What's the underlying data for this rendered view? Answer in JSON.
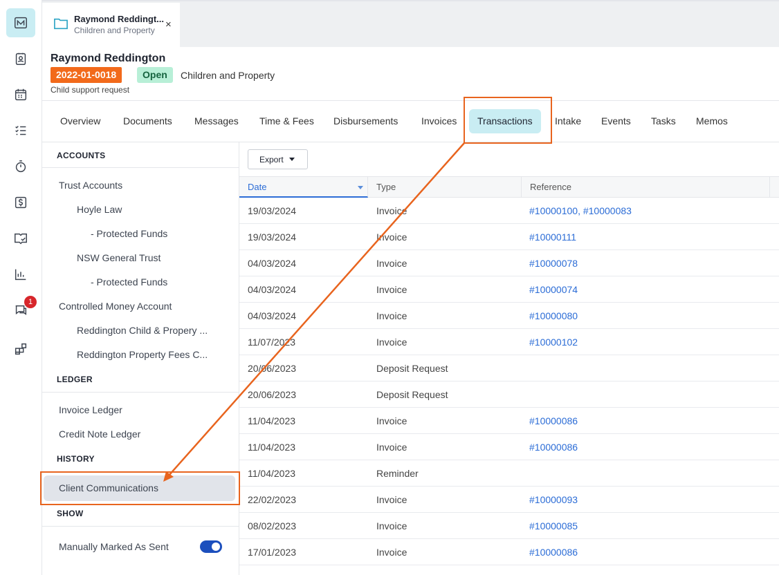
{
  "rail": {
    "items": [
      "matter-icon",
      "contacts-icon",
      "calendar-icon",
      "tasks-icon",
      "timer-icon",
      "billing-icon",
      "library-icon",
      "reports-icon",
      "communications-icon",
      "apps-icon"
    ],
    "badge": "1"
  },
  "tab": {
    "title": "Raymond Reddingt...",
    "subtitle": "Children and Property",
    "close": "×"
  },
  "header": {
    "client_name": "Raymond Reddington",
    "matter_number": "2022-01-0018",
    "status": "Open",
    "matter_type": "Children and Property",
    "description": "Child support request"
  },
  "nav": {
    "tabs": [
      "Overview",
      "Documents",
      "Messages",
      "Time & Fees",
      "Disbursements",
      "Invoices",
      "Transactions",
      "Intake",
      "Events",
      "Tasks",
      "Memos"
    ],
    "active": "Transactions"
  },
  "sidebar": {
    "accounts_heading": "ACCOUNTS",
    "trust_accounts": "Trust Accounts",
    "hoyle_law": "Hoyle Law",
    "protected_funds_1": "- Protected Funds",
    "nsw_general_trust": "NSW General Trust",
    "protected_funds_2": "- Protected Funds",
    "controlled_money": "Controlled Money Account",
    "cma_1": "Reddington Child & Propery ...",
    "cma_2": "Reddington Property Fees C...",
    "ledger_heading": "LEDGER",
    "invoice_ledger": "Invoice Ledger",
    "credit_note_ledger": "Credit Note Ledger",
    "history_heading": "HISTORY",
    "client_communications": "Client Communications",
    "show_heading": "SHOW",
    "manually_marked": "Manually Marked As Sent",
    "manually_marked_on": true
  },
  "grid": {
    "export_label": "Export",
    "columns": [
      "Date",
      "Type",
      "Reference"
    ],
    "rows": [
      {
        "date": "19/03/2024",
        "type": "Invoice",
        "ref": "#10000100, #10000083"
      },
      {
        "date": "19/03/2024",
        "type": "Invoice",
        "ref": "#10000111"
      },
      {
        "date": "04/03/2024",
        "type": "Invoice",
        "ref": "#10000078"
      },
      {
        "date": "04/03/2024",
        "type": "Invoice",
        "ref": "#10000074"
      },
      {
        "date": "04/03/2024",
        "type": "Invoice",
        "ref": "#10000080"
      },
      {
        "date": "11/07/2023",
        "type": "Invoice",
        "ref": "#10000102"
      },
      {
        "date": "20/06/2023",
        "type": "Deposit Request",
        "ref": ""
      },
      {
        "date": "20/06/2023",
        "type": "Deposit Request",
        "ref": ""
      },
      {
        "date": "11/04/2023",
        "type": "Invoice",
        "ref": "#10000086"
      },
      {
        "date": "11/04/2023",
        "type": "Invoice",
        "ref": "#10000086"
      },
      {
        "date": "11/04/2023",
        "type": "Reminder",
        "ref": ""
      },
      {
        "date": "22/02/2023",
        "type": "Invoice",
        "ref": "#10000093"
      },
      {
        "date": "08/02/2023",
        "type": "Invoice",
        "ref": "#10000085"
      },
      {
        "date": "17/01/2023",
        "type": "Invoice",
        "ref": "#10000086"
      }
    ]
  },
  "colors": {
    "accent_orange": "#e8641e",
    "active_tab_bg": "#c9edf3",
    "link_blue": "#2b6cd6",
    "matter_number_bg": "#f26a1b",
    "status_bg": "#b8efd7",
    "toggle_on": "#1c4fbd"
  }
}
